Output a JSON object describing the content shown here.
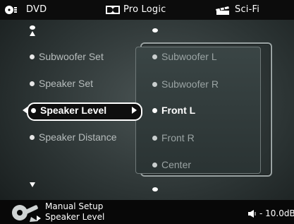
{
  "topbar": {
    "source_label": "DVD",
    "surround_label": "Pro Logic",
    "mode_label": "Sci-Fi"
  },
  "left_menu": [
    {
      "label": "Subwoofer Set"
    },
    {
      "label": "Speaker Set"
    },
    {
      "label": "Speaker Level"
    },
    {
      "label": "Speaker Distance"
    }
  ],
  "right_menu": [
    {
      "label": "Subwoofer L"
    },
    {
      "label": "Subwoofer R"
    },
    {
      "label": "Front L"
    },
    {
      "label": "Front R"
    },
    {
      "label": "Center"
    }
  ],
  "bottom": {
    "line1": "Manual Setup",
    "line2": "Speaker Level",
    "volume": "- 10.0dB"
  },
  "colors": {
    "active_text": "#ffffff",
    "inactive_text": "#b7bdbd",
    "panel_border": "#9aa3a3"
  }
}
